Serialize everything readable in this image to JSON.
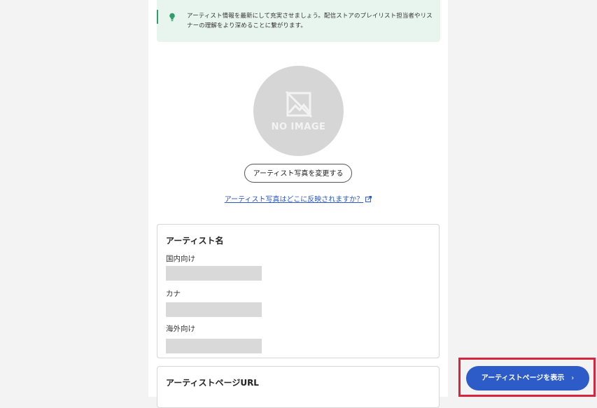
{
  "tip": {
    "text": "アーティスト情報を最新にして充実させましょう。配信ストアのプレイリスト担当者やリスナーの理解をより深めることに繋がります。"
  },
  "photo": {
    "placeholder": "NO IMAGE",
    "change_button": "アーティスト写真を変更する",
    "help_link": "アーティスト写真はどこに反映されますか？"
  },
  "artist_name": {
    "title": "アーティスト名",
    "fields": [
      {
        "label": "国内向け"
      },
      {
        "label": "カナ"
      },
      {
        "label": "海外向け"
      }
    ]
  },
  "artist_page_url": {
    "title": "アーティストページURL"
  },
  "cta": {
    "label": "アーティストページを表示",
    "chevron": "›"
  },
  "colors": {
    "accent": "#2d5bc8",
    "tip_bg": "#e8f5ee",
    "tip_accent": "#2e9e6a",
    "highlight": "#d8253b"
  }
}
